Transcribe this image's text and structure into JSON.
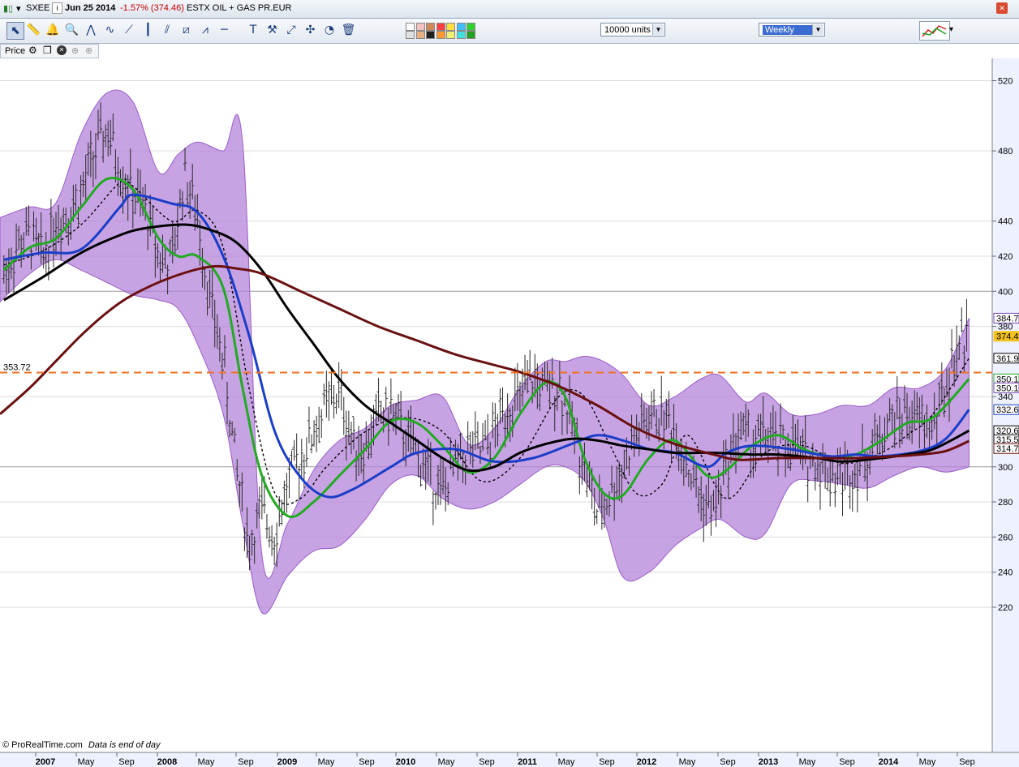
{
  "window": {
    "symbol": "SXEE",
    "date": "Jun 25 2014",
    "change": "-1.57% (374.46)",
    "name": "ESTX OIL + GAS PR.EUR"
  },
  "toolbar": {
    "units_value": "10000 units",
    "period_value": "Weekly",
    "tool_icons": [
      "pointer-icon",
      "ruler-icon",
      "alert-bell-icon",
      "zoom-icon",
      "fan-icon",
      "wave-icon",
      "trendline-icon",
      "vertical-line-icon",
      "parallel-lines-icon",
      "channel-icon",
      "fibonacci-icon",
      "horizontal-line-icon",
      "text-icon",
      "tools-icon",
      "arrow-icon",
      "cross-arrows-icon",
      "gauge-icon",
      "trash-icon"
    ],
    "colors": [
      "#ffffff",
      "#e0e0e0",
      "#f4c0c0",
      "#e8b080",
      "#d08a5a",
      "#202020",
      "#ff4040",
      "#ff9a30",
      "#ffe040",
      "#f0f070",
      "#40c0ff",
      "#40e0e0",
      "#30d030",
      "#20a020"
    ]
  },
  "panel": {
    "label": "Price"
  },
  "footer": {
    "credit": "© ProRealTime.com",
    "note": "Data is end of day"
  },
  "chart_data": {
    "type": "line",
    "title": "",
    "xlabel": "",
    "ylabel": "",
    "ylim": [
      212,
      526
    ],
    "y_ticks": [
      220,
      240,
      260,
      280,
      300,
      340,
      380,
      400,
      420,
      440,
      480,
      520
    ],
    "x_ticks": [
      "2007",
      "May",
      "Sep",
      "2008",
      "May",
      "Sep",
      "2009",
      "May",
      "Sep",
      "2010",
      "May",
      "Sep",
      "2011",
      "May",
      "Sep",
      "2012",
      "May",
      "Sep",
      "2013",
      "May",
      "Sep",
      "2014",
      "May",
      "Sep"
    ],
    "x_range": [
      2006.97,
      2014.66
    ],
    "reference_line": {
      "value": 353.72,
      "label": "353.72",
      "color": "#f07020"
    },
    "series": [
      {
        "color": "#2a2a2a",
        "style": "weekly-bars",
        "x": [
          2007.0,
          2007.1,
          2007.2,
          2007.3,
          2007.4,
          2007.5,
          2007.6,
          2007.7,
          2007.8,
          2007.9,
          2008.0,
          2008.1,
          2008.2,
          2008.3,
          2008.4,
          2008.5,
          2008.6,
          2008.7,
          2008.8,
          2008.9,
          2009.0,
          2009.1,
          2009.2,
          2009.3,
          2009.4,
          2009.5,
          2009.6,
          2009.7,
          2009.8,
          2009.9,
          2010.0,
          2010.1,
          2010.2,
          2010.3,
          2010.4,
          2010.5,
          2010.6,
          2010.7,
          2010.8,
          2010.9,
          2011.0,
          2011.1,
          2011.2,
          2011.3,
          2011.4,
          2011.5,
          2011.6,
          2011.7,
          2011.8,
          2011.9,
          2012.0,
          2012.1,
          2012.2,
          2012.3,
          2012.4,
          2012.5,
          2012.6,
          2012.7,
          2012.8,
          2012.9,
          2013.0,
          2013.1,
          2013.2,
          2013.3,
          2013.4,
          2013.5,
          2013.6,
          2013.7,
          2013.8,
          2013.9,
          2014.0,
          2014.1,
          2014.2,
          2014.3,
          2014.4,
          2014.48
        ],
        "values": [
          410,
          425,
          432,
          418,
          440,
          445,
          455,
          478,
          492,
          470,
          455,
          445,
          420,
          415,
          468,
          442,
          395,
          360,
          300,
          255,
          275,
          262,
          290,
          305,
          320,
          335,
          342,
          315,
          310,
          330,
          332,
          318,
          308,
          295,
          285,
          300,
          310,
          308,
          320,
          335,
          338,
          350,
          342,
          348,
          325,
          300,
          272,
          285,
          300,
          318,
          328,
          330,
          322,
          300,
          282,
          275,
          300,
          322,
          312,
          318,
          311,
          313,
          305,
          302,
          297,
          294,
          299,
          307,
          320,
          328,
          330,
          325,
          322,
          345,
          370,
          374.46
        ]
      },
      {
        "color": "#000000",
        "style": "dashed",
        "x": [
          2007.0,
          2007.3,
          2007.6,
          2007.9,
          2008.0,
          2008.3,
          2008.5,
          2008.7,
          2008.9,
          2009.1,
          2009.3,
          2009.5,
          2009.8,
          2010.1,
          2010.4,
          2010.7,
          2011.0,
          2011.3,
          2011.5,
          2011.7,
          2011.9,
          2012.1,
          2012.3,
          2012.6,
          2012.9,
          2013.2,
          2013.5,
          2013.8,
          2014.0,
          2014.2,
          2014.48
        ],
        "values": [
          415,
          423,
          438,
          462,
          460,
          440,
          446,
          425,
          345,
          285,
          282,
          300,
          320,
          328,
          320,
          292,
          305,
          340,
          340,
          312,
          285,
          290,
          318,
          282,
          308,
          312,
          302,
          308,
          318,
          330,
          361.9
        ]
      },
      {
        "name": "",
        "color": "#22aa22",
        "x": [
          2007.0,
          2007.2,
          2007.4,
          2007.6,
          2007.8,
          2008.0,
          2008.2,
          2008.35,
          2008.5,
          2008.7,
          2008.85,
          2009.0,
          2009.2,
          2009.4,
          2009.6,
          2009.8,
          2010.0,
          2010.2,
          2010.4,
          2010.6,
          2010.8,
          2011.0,
          2011.2,
          2011.35,
          2011.5,
          2011.65,
          2011.8,
          2012.0,
          2012.2,
          2012.45,
          2012.6,
          2012.8,
          2013.0,
          2013.2,
          2013.4,
          2013.6,
          2013.8,
          2014.0,
          2014.2,
          2014.48
        ],
        "values": [
          412,
          425,
          430,
          448,
          464,
          458,
          430,
          420,
          420,
          402,
          345,
          295,
          272,
          280,
          295,
          310,
          326,
          325,
          312,
          297,
          305,
          330,
          348,
          340,
          305,
          285,
          284,
          305,
          315,
          295,
          298,
          312,
          318,
          310,
          306,
          307,
          315,
          325,
          328,
          350.1
        ]
      },
      {
        "name": "",
        "color": "#1a3ec8",
        "x": [
          2007.0,
          2007.3,
          2007.6,
          2007.9,
          2008.0,
          2008.3,
          2008.5,
          2008.7,
          2008.9,
          2009.1,
          2009.3,
          2009.5,
          2009.7,
          2010.0,
          2010.2,
          2010.5,
          2010.8,
          2011.1,
          2011.4,
          2011.6,
          2011.8,
          2012.0,
          2012.2,
          2012.45,
          2012.6,
          2012.8,
          2013.1,
          2013.4,
          2013.6,
          2013.8,
          2014.1,
          2014.3,
          2014.48
        ],
        "values": [
          418,
          422,
          424,
          448,
          455,
          450,
          445,
          420,
          375,
          320,
          294,
          283,
          287,
          300,
          308,
          310,
          303,
          305,
          313,
          318,
          315,
          310,
          308,
          300,
          308,
          312,
          310,
          306,
          307,
          306,
          309,
          316,
          332.6
        ]
      },
      {
        "name": "",
        "color": "#000000",
        "x": [
          2007.0,
          2007.3,
          2007.6,
          2007.9,
          2008.1,
          2008.4,
          2008.6,
          2008.8,
          2009.0,
          2009.2,
          2009.4,
          2009.6,
          2009.8,
          2010.0,
          2010.2,
          2010.4,
          2010.6,
          2010.8,
          2011.0,
          2011.2,
          2011.4,
          2011.6,
          2011.8,
          2012.0,
          2012.2,
          2012.5,
          2012.8,
          2013.0,
          2013.3,
          2013.5,
          2013.8,
          2014.0,
          2014.2,
          2014.48
        ],
        "values": [
          395,
          408,
          422,
          432,
          436,
          438,
          435,
          428,
          412,
          390,
          370,
          350,
          335,
          325,
          315,
          305,
          298,
          300,
          308,
          313,
          316,
          315,
          312,
          310,
          308,
          308,
          307,
          307,
          305,
          303,
          305,
          307,
          310,
          320.6
        ]
      },
      {
        "name": "",
        "color": "#6a1010",
        "x": [
          2006.97,
          2007.2,
          2007.4,
          2007.6,
          2007.8,
          2008.0,
          2008.3,
          2008.6,
          2008.8,
          2009.0,
          2009.3,
          2009.6,
          2009.9,
          2010.2,
          2010.5,
          2010.8,
          2011.0,
          2011.3,
          2011.6,
          2011.9,
          2012.2,
          2012.5,
          2012.7,
          2013.0,
          2013.3,
          2013.6,
          2013.9,
          2014.1,
          2014.3,
          2014.48
        ],
        "values": [
          330,
          345,
          360,
          375,
          388,
          398,
          408,
          414,
          413,
          410,
          400,
          390,
          380,
          372,
          364,
          358,
          354,
          346,
          335,
          322,
          313,
          307,
          304,
          305,
          305,
          305,
          306,
          307,
          309,
          314.7
        ]
      }
    ],
    "bands": {
      "color": "#b27fd8",
      "x": [
        2006.97,
        2007.2,
        2007.4,
        2007.6,
        2007.8,
        2008.0,
        2008.2,
        2008.35,
        2008.5,
        2008.7,
        2008.85,
        2009.0,
        2009.2,
        2009.4,
        2009.6,
        2009.8,
        2010.0,
        2010.2,
        2010.4,
        2010.6,
        2010.8,
        2011.0,
        2011.2,
        2011.35,
        2011.5,
        2011.65,
        2011.8,
        2012.0,
        2012.2,
        2012.4,
        2012.55,
        2012.75,
        2012.9,
        2013.1,
        2013.3,
        2013.5,
        2013.7,
        2013.9,
        2014.1,
        2014.3,
        2014.48
      ],
      "upper": [
        442,
        448,
        450,
        490,
        513,
        508,
        468,
        478,
        485,
        480,
        485,
        250,
        268,
        298,
        315,
        322,
        335,
        338,
        340,
        313,
        322,
        345,
        360,
        360,
        363,
        360,
        352,
        335,
        340,
        350,
        352,
        337,
        342,
        330,
        330,
        335,
        335,
        345,
        345,
        356,
        384.7
      ],
      "lower": [
        394,
        410,
        418,
        412,
        405,
        398,
        395,
        390,
        370,
        330,
        268,
        217,
        238,
        252,
        255,
        270,
        290,
        295,
        282,
        276,
        280,
        290,
        300,
        300,
        292,
        270,
        237,
        240,
        255,
        265,
        270,
        260,
        262,
        290,
        292,
        290,
        288,
        295,
        300,
        297,
        300
      ]
    },
    "right_labels": [
      {
        "value": 384.7,
        "label": "384.7",
        "color": "#7a4ab0"
      },
      {
        "value": 374.4,
        "label": "374.4",
        "color": "#f4c21a"
      },
      {
        "value": 361.9,
        "label": "361.9",
        "color": "#000000"
      },
      {
        "value": 350.1,
        "label": "350.1",
        "color": "#22aa22"
      },
      {
        "value": 350.1,
        "label": "350.1",
        "color": "#7a4ab0"
      },
      {
        "value": 332.6,
        "label": "332.6",
        "color": "#1a3ec8"
      },
      {
        "value": 320.6,
        "label": "320.6",
        "color": "#000000"
      },
      {
        "value": 315.5,
        "label": "315.5",
        "color": "#000000"
      },
      {
        "value": 314.7,
        "label": "314.7",
        "color": "#6a1010"
      }
    ]
  }
}
